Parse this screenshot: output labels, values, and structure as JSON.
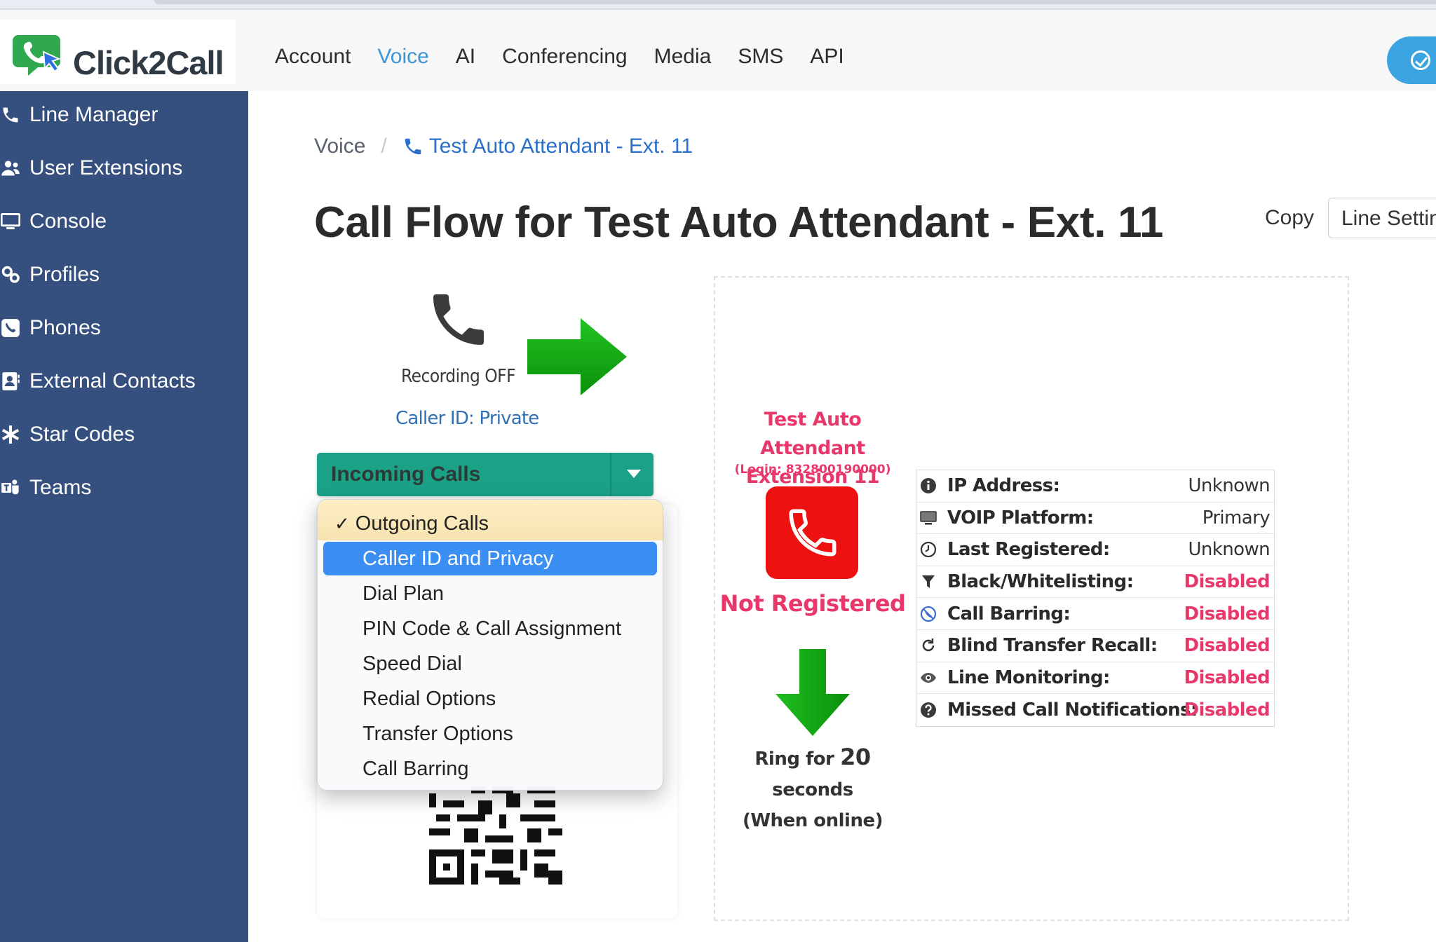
{
  "app": {
    "logo_text": "Click2Call"
  },
  "topnav": [
    {
      "label": "Account",
      "active": false
    },
    {
      "label": "Voice",
      "active": true
    },
    {
      "label": "AI",
      "active": false
    },
    {
      "label": "Conferencing",
      "active": false
    },
    {
      "label": "Media",
      "active": false
    },
    {
      "label": "SMS",
      "active": false
    },
    {
      "label": "API",
      "active": false
    }
  ],
  "sidebar": {
    "items": [
      {
        "label": "Line Manager",
        "icon": "phone-icon"
      },
      {
        "label": "User Extensions",
        "icon": "users-icon"
      },
      {
        "label": "Console",
        "icon": "monitor-icon"
      },
      {
        "label": "Profiles",
        "icon": "gears-icon"
      },
      {
        "label": "Phones",
        "icon": "phone-square-icon"
      },
      {
        "label": "External Contacts",
        "icon": "contact-card-icon"
      },
      {
        "label": "Star Codes",
        "icon": "asterisk-icon"
      },
      {
        "label": "Teams",
        "icon": "team-icon"
      }
    ]
  },
  "breadcrumb": {
    "root": "Voice",
    "separator": "/",
    "current": "Test Auto Attendant - Ext. 11"
  },
  "page": {
    "title": "Call Flow for Test Auto Attendant - Ext. 11",
    "copy_label": "Copy",
    "line_settings_label": "Line Settings"
  },
  "left_flow": {
    "recording": "Recording OFF",
    "caller_id": "Caller ID: Private",
    "direction_select": "Incoming Calls"
  },
  "dropdown": {
    "header": "Outgoing Calls",
    "items": [
      {
        "label": "Caller ID and Privacy",
        "selected": true
      },
      {
        "label": "Dial Plan",
        "selected": false
      },
      {
        "label": "PIN Code & Call Assignment",
        "selected": false
      },
      {
        "label": "Speed Dial",
        "selected": false
      },
      {
        "label": "Redial Options",
        "selected": false
      },
      {
        "label": "Transfer Options",
        "selected": false
      },
      {
        "label": "Call Barring",
        "selected": false
      }
    ]
  },
  "extension": {
    "name": "Test Auto Attendant",
    "number_label": "Extension 11",
    "login": "(Login: 832800190000)",
    "status": "Not Registered",
    "ring_prefix": "Ring for",
    "ring_seconds": "20",
    "ring_suffix": "seconds",
    "ring_condition": "(When online)"
  },
  "status_table": [
    {
      "icon": "info-icon",
      "label": "IP Address:",
      "value": "Unknown",
      "disabled": false
    },
    {
      "icon": "monitor-icon",
      "label": "VOIP Platform:",
      "value": "Primary",
      "disabled": false
    },
    {
      "icon": "clock-icon",
      "label": "Last Registered:",
      "value": "Unknown",
      "disabled": false
    },
    {
      "icon": "filter-icon",
      "label": "Black/Whitelisting:",
      "value": "Disabled",
      "disabled": true
    },
    {
      "icon": "call-barring-icon",
      "label": "Call Barring:",
      "value": "Disabled",
      "disabled": true
    },
    {
      "icon": "refresh-icon",
      "label": "Blind Transfer Recall:",
      "value": "Disabled",
      "disabled": true
    },
    {
      "icon": "eye-icon",
      "label": "Line Monitoring:",
      "value": "Disabled",
      "disabled": true
    },
    {
      "icon": "question-icon",
      "label": "Missed Call Notifications:",
      "value": "Disabled",
      "disabled": true
    }
  ],
  "colors": {
    "sidebar": "#354f7e",
    "accent_blue": "#3b95d6",
    "alert_pink": "#e8386a",
    "select_green": "#1aa186",
    "dropdown_selected": "#3b8ff2"
  }
}
